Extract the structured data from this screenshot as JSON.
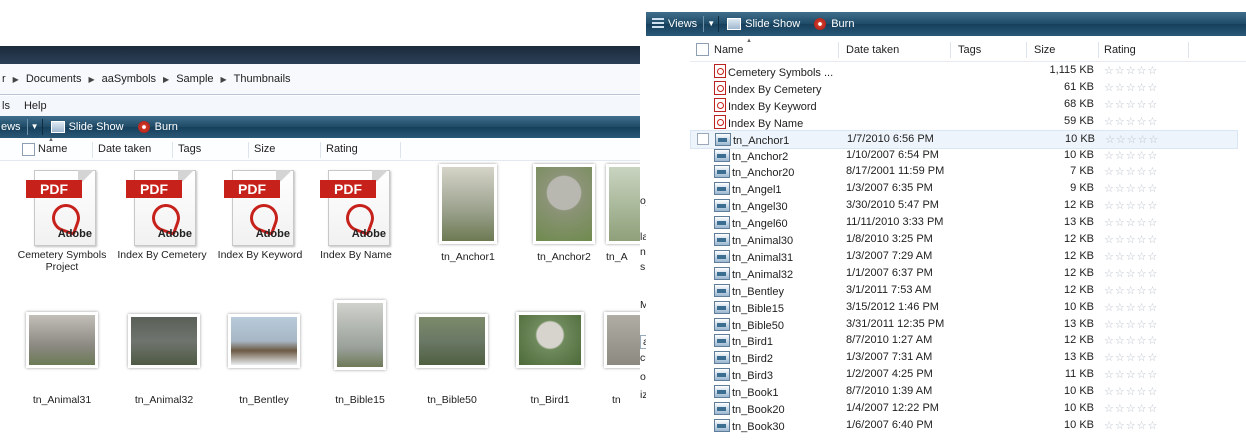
{
  "left_window": {
    "breadcrumb": [
      "r",
      "Documents",
      "aaSymbols",
      "Sample",
      "Thumbnails"
    ],
    "menu": [
      "ls",
      "Help"
    ],
    "toolbar": {
      "views": "ews",
      "slideshow": "Slide Show",
      "burn": "Burn"
    },
    "columns": [
      "Name",
      "Date taken",
      "Tags",
      "Size",
      "Rating"
    ],
    "icons": [
      {
        "label": "Cemetery Symbols Project",
        "type": "pdf"
      },
      {
        "label": "Index By Cemetery",
        "type": "pdf"
      },
      {
        "label": "Index By Keyword",
        "type": "pdf"
      },
      {
        "label": "Index By Name",
        "type": "pdf"
      },
      {
        "label": "tn_Anchor1",
        "type": "photo",
        "color": "#9aa08c"
      },
      {
        "label": "tn_Anchor2",
        "type": "photo",
        "color": "#8c9478"
      },
      {
        "label": "tn_A",
        "type": "photo",
        "color": "#8fa07a"
      },
      {
        "label": "tn_Animal31",
        "type": "photo",
        "color": "#8d8a84"
      },
      {
        "label": "tn_Animal32",
        "type": "photo",
        "color": "#6f746e"
      },
      {
        "label": "tn_Bentley",
        "type": "photo",
        "color": "#a7b6c4"
      },
      {
        "label": "tn_Bible15",
        "type": "photo",
        "color": "#9aa09a"
      },
      {
        "label": "tn_Bible50",
        "type": "photo",
        "color": "#6a7866"
      },
      {
        "label": "tn_Bird1",
        "type": "photo",
        "color": "#6f8a5c"
      },
      {
        "label": "tn",
        "type": "photo",
        "color": "#8c8a80"
      }
    ],
    "pdf_banner": "PDF",
    "pdf_brand": "Adobe"
  },
  "sidebar_fragment": {
    "items": [
      "oject",
      "lag H",
      "ntranc",
      "s",
      "Move",
      "ails",
      "cumer",
      "otos",
      "ize"
    ]
  },
  "right_window": {
    "toolbar": {
      "views": "Views",
      "slideshow": "Slide Show",
      "burn": "Burn"
    },
    "columns": [
      "Name",
      "Date taken",
      "Tags",
      "Size",
      "Rating"
    ],
    "rows": [
      {
        "name": "Cemetery Symbols ...",
        "date": "",
        "size": "1,115 KB",
        "icon": "pdf"
      },
      {
        "name": "Index By Cemetery",
        "date": "",
        "size": "61 KB",
        "icon": "pdf"
      },
      {
        "name": "Index By Keyword",
        "date": "",
        "size": "68 KB",
        "icon": "pdf"
      },
      {
        "name": "Index By Name",
        "date": "",
        "size": "59 KB",
        "icon": "pdf"
      },
      {
        "name": "tn_Anchor1",
        "date": "1/7/2010 6:56 PM",
        "size": "10 KB",
        "icon": "img",
        "selected": true
      },
      {
        "name": "tn_Anchor2",
        "date": "1/10/2007 6:54 PM",
        "size": "10 KB",
        "icon": "img"
      },
      {
        "name": "tn_Anchor20",
        "date": "8/17/2001 11:59 PM",
        "size": "7 KB",
        "icon": "img"
      },
      {
        "name": "tn_Angel1",
        "date": "1/3/2007 6:35 PM",
        "size": "9 KB",
        "icon": "img"
      },
      {
        "name": "tn_Angel30",
        "date": "3/30/2010 5:47 PM",
        "size": "12 KB",
        "icon": "img"
      },
      {
        "name": "tn_Angel60",
        "date": "11/11/2010 3:33 PM",
        "size": "13 KB",
        "icon": "img"
      },
      {
        "name": "tn_Animal30",
        "date": "1/8/2010 3:25 PM",
        "size": "12 KB",
        "icon": "img"
      },
      {
        "name": "tn_Animal31",
        "date": "1/3/2007 7:29 AM",
        "size": "12 KB",
        "icon": "img"
      },
      {
        "name": "tn_Animal32",
        "date": "1/1/2007 6:37 PM",
        "size": "12 KB",
        "icon": "img"
      },
      {
        "name": "tn_Bentley",
        "date": "3/1/2011 7:53 AM",
        "size": "12 KB",
        "icon": "img"
      },
      {
        "name": "tn_Bible15",
        "date": "3/15/2012 1:46 PM",
        "size": "10 KB",
        "icon": "img"
      },
      {
        "name": "tn_Bible50",
        "date": "3/31/2011 12:35 PM",
        "size": "13 KB",
        "icon": "img"
      },
      {
        "name": "tn_Bird1",
        "date": "8/7/2010 1:27 AM",
        "size": "12 KB",
        "icon": "img"
      },
      {
        "name": "tn_Bird2",
        "date": "1/3/2007 7:31 AM",
        "size": "13 KB",
        "icon": "img"
      },
      {
        "name": "tn_Bird3",
        "date": "1/2/2007 4:25 PM",
        "size": "11 KB",
        "icon": "img"
      },
      {
        "name": "tn_Book1",
        "date": "8/7/2010 1:39 AM",
        "size": "10 KB",
        "icon": "img"
      },
      {
        "name": "tn_Book20",
        "date": "1/4/2007 12:22 PM",
        "size": "10 KB",
        "icon": "img"
      },
      {
        "name": "tn_Book30",
        "date": "1/6/2007 6:40 PM",
        "size": "10 KB",
        "icon": "img"
      }
    ],
    "rating_glyphs": "☆☆☆☆☆"
  },
  "colors": {
    "toolbar": "#1e4a66",
    "pdf_red": "#c7211b",
    "selection": "#eef4fb"
  }
}
